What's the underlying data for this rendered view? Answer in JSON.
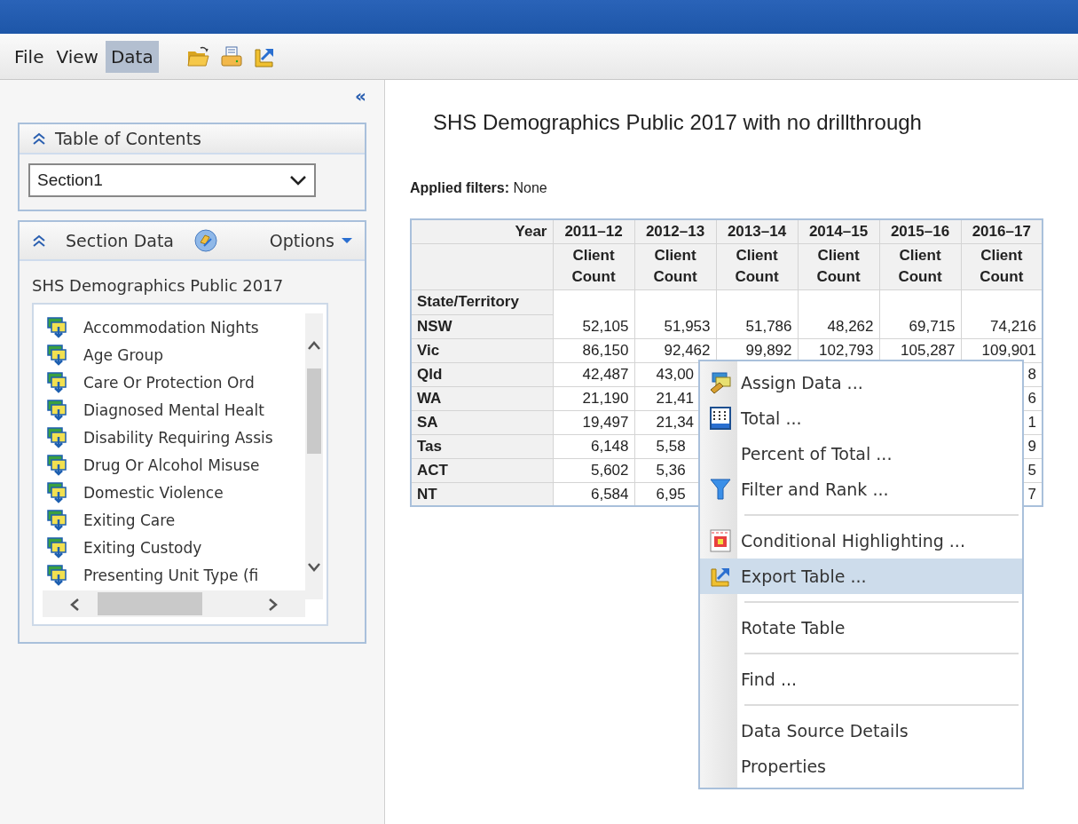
{
  "collapse_button": "«",
  "menubar": [
    {
      "label": "File",
      "selected": false
    },
    {
      "label": "View",
      "selected": false
    },
    {
      "label": "Data",
      "selected": true
    }
  ],
  "toc": {
    "title": "Table of Contents",
    "select_value": "Section1"
  },
  "section_data": {
    "title": "Section Data",
    "options": "Options",
    "source": "SHS Demographics Public 2017",
    "items": [
      "Accommodation Nights",
      "Age Group",
      "Care Or Protection Ord",
      "Diagnosed Mental Healt",
      "Disability Requiring Assis",
      "Drug Or Alcohol Misuse",
      "Domestic Violence",
      "Exiting Care",
      "Exiting Custody",
      "Presenting Unit Type (fi"
    ]
  },
  "report": {
    "title": "SHS Demographics Public 2017 with no drillthrough",
    "filters_label": "Applied filters:",
    "filters_value": "None"
  },
  "table": {
    "corner": "Year",
    "columns": [
      {
        "year": "2011–12",
        "measure": "Client Count"
      },
      {
        "year": "2012–13",
        "measure": "Client Count"
      },
      {
        "year": "2013–14",
        "measure": "Client Count"
      },
      {
        "year": "2014–15",
        "measure": "Client Count"
      },
      {
        "year": "2015–16",
        "measure": "Client Count"
      },
      {
        "year": "2016–17",
        "measure": "Client Count"
      }
    ],
    "row_header": "State/Territory",
    "rows": [
      {
        "label": "NSW",
        "values": [
          "52,105",
          "51,953",
          "51,786",
          "48,262",
          "69,715",
          "74,216"
        ]
      },
      {
        "label": "Vic",
        "values": [
          "86,150",
          "92,462",
          "99,892",
          "102,793",
          "105,287",
          "109,901"
        ]
      },
      {
        "label": "Qld",
        "values": [
          "42,487",
          "43,00"
        ],
        "last_column": "8"
      },
      {
        "label": "WA",
        "values": [
          "21,190",
          "21,41"
        ],
        "last_column": "6"
      },
      {
        "label": "SA",
        "values": [
          "19,497",
          "21,34"
        ],
        "last_column": "1"
      },
      {
        "label": "Tas",
        "values": [
          "6,148",
          "5,58"
        ],
        "last_column": "9"
      },
      {
        "label": "ACT",
        "values": [
          "5,602",
          "5,36"
        ],
        "last_column": "5"
      },
      {
        "label": "NT",
        "values": [
          "6,584",
          "6,95"
        ],
        "last_column": "7"
      }
    ]
  },
  "context_menu": [
    {
      "kind": "item",
      "label": "Assign Data ...",
      "selected": false
    },
    {
      "kind": "item",
      "label": "Total ...",
      "selected": false
    },
    {
      "kind": "item",
      "label": "Percent of Total ...",
      "selected": false
    },
    {
      "kind": "item",
      "label": "Filter and Rank ...",
      "selected": false
    },
    {
      "kind": "separator"
    },
    {
      "kind": "item",
      "label": "Conditional Highlighting ...",
      "selected": false
    },
    {
      "kind": "item",
      "label": "Export Table ...",
      "selected": true
    },
    {
      "kind": "separator"
    },
    {
      "kind": "item",
      "label": "Rotate Table",
      "selected": false
    },
    {
      "kind": "separator"
    },
    {
      "kind": "item",
      "label": "Find ...",
      "selected": false
    },
    {
      "kind": "separator"
    },
    {
      "kind": "item",
      "label": "Data Source Details",
      "selected": false
    },
    {
      "kind": "item",
      "label": "Properties",
      "selected": false
    }
  ]
}
